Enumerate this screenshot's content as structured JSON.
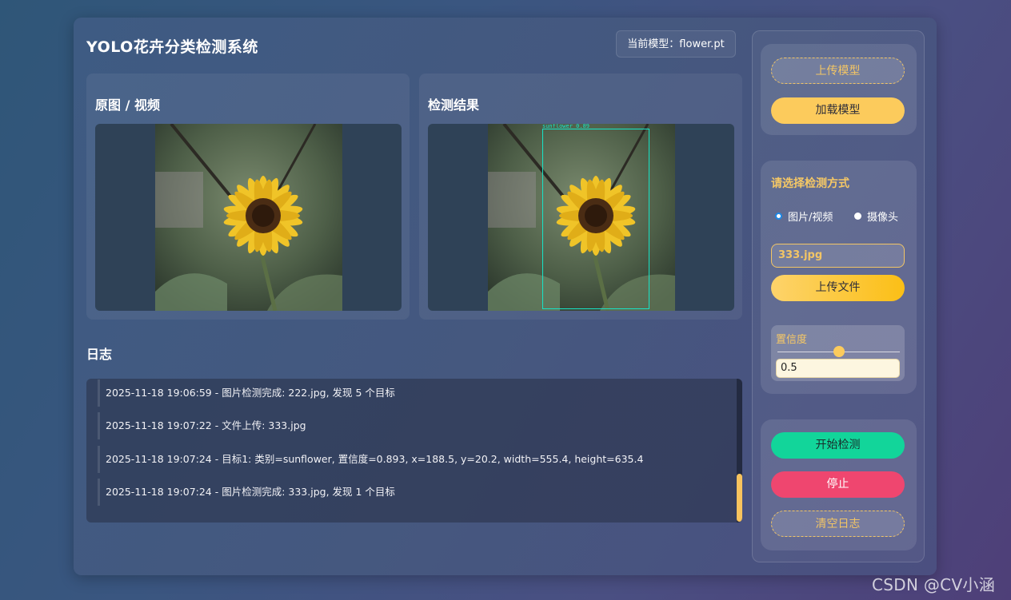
{
  "app": {
    "title": "YOLO花卉分类检测系统",
    "current_model": "当前模型：flower.pt"
  },
  "panels": {
    "original_title": "原图 / 视频",
    "result_title": "检测结果",
    "detection_label": "sunflower 0.89"
  },
  "log": {
    "title": "日志",
    "entries": [
      "2025-11-18 19:06:59 - 图片检测完成: 222.jpg, 发现 5 个目标",
      "2025-11-18 19:07:22 - 文件上传: 333.jpg",
      "2025-11-18 19:07:24 - 目标1: 类别=sunflower, 置信度=0.893, x=188.5, y=20.2, width=555.4, height=635.4",
      "2025-11-18 19:07:24 - 图片检测完成: 333.jpg, 发现 1 个目标"
    ]
  },
  "sidebar": {
    "upload_model": "上传模型",
    "load_model": "加载模型",
    "mode_label": "请选择检测方式",
    "mode_options": [
      "图片/视频",
      "摄像头"
    ],
    "selected_mode": "图片/视频",
    "file_name": "333.jpg",
    "upload_file": "上传文件",
    "confidence_label": "置信度",
    "confidence_value": "0.5",
    "confidence_fraction": 0.5,
    "start_detect": "开始检测",
    "stop": "停止",
    "clear_log": "清空日志"
  },
  "colors": {
    "accent_yellow": "#fccb5c",
    "start_green": "#12d59a",
    "stop_red": "#ef466f",
    "bbox_cyan": "#18e4c7"
  },
  "watermark": "CSDN @CV小涵"
}
